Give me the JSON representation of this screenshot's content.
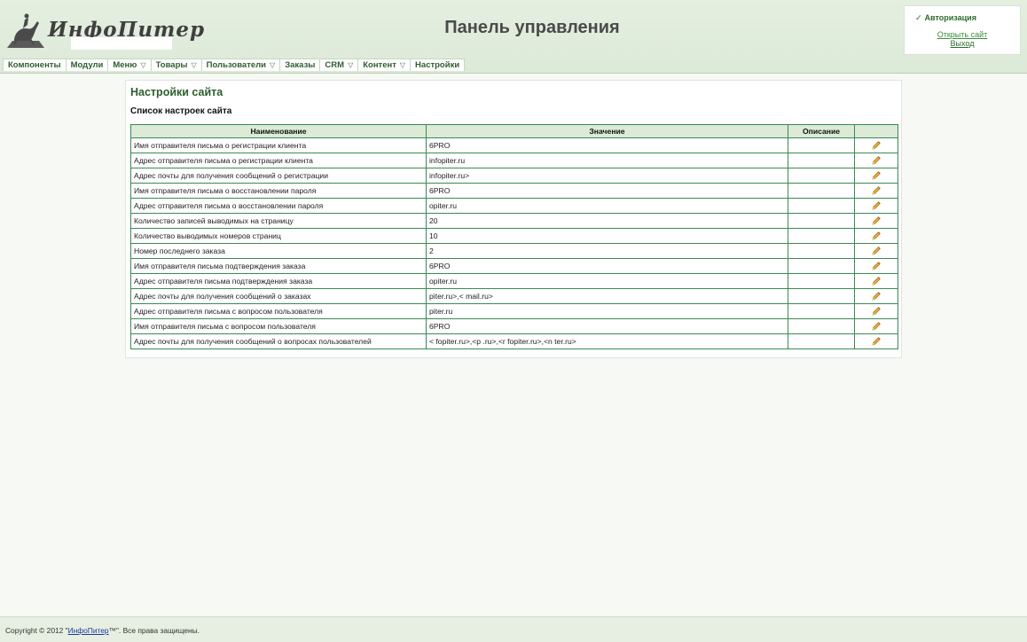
{
  "header": {
    "logo_text": "ИнфоПитер",
    "title": "Панель управления"
  },
  "auth": {
    "title": "Авторизация",
    "open_site": "Открыть сайт",
    "logout": "Выход"
  },
  "nav": [
    {
      "label": "Компоненты",
      "dropdown": false
    },
    {
      "label": "Модули",
      "dropdown": false
    },
    {
      "label": "Меню",
      "dropdown": true
    },
    {
      "label": "Товары",
      "dropdown": true
    },
    {
      "label": "Пользователи",
      "dropdown": true
    },
    {
      "label": "Заказы",
      "dropdown": false
    },
    {
      "label": "CRM",
      "dropdown": true
    },
    {
      "label": "Контент",
      "dropdown": true
    },
    {
      "label": "Настройки",
      "dropdown": false
    }
  ],
  "content": {
    "title": "Настройки сайта",
    "subtitle": "Список настроек сайта",
    "columns": [
      "Наименование",
      "Значение",
      "Описание",
      ""
    ],
    "rows": [
      {
        "name": "Имя отправителя письма о регистрации клиента",
        "value": "6PRO",
        "description": ""
      },
      {
        "name": "Адрес отправителя письма о регистрации клиента",
        "value": "              infopiter.ru",
        "description": ""
      },
      {
        "name": "Адрес почты для получения сообщений о регистрации",
        "value": "               infopiter.ru>",
        "description": ""
      },
      {
        "name": "Имя отправителя письма о восстановлении пароля",
        "value": "6PRO",
        "description": ""
      },
      {
        "name": "Адрес отправителя письма о восстановлении пароля",
        "value": "                  opiter.ru",
        "description": ""
      },
      {
        "name": "Количество записей выводимых на страницу",
        "value": "20",
        "description": ""
      },
      {
        "name": "Количество выводимых номеров страниц",
        "value": "10",
        "description": ""
      },
      {
        "name": "Номер последнего заказа",
        "value": "2",
        "description": ""
      },
      {
        "name": "Имя отправителя письма подтверждения заказа",
        "value": "6PRO",
        "description": ""
      },
      {
        "name": "Адрес отправителя письма подтверждения заказа",
        "value": "                  opiter.ru",
        "description": ""
      },
      {
        "name": "Адрес почты для получения сообщений о заказах",
        "value": "               piter.ru>,<              mail.ru>",
        "description": ""
      },
      {
        "name": "Адрес отправителя письма с вопросом пользователя",
        "value": "                  piter.ru",
        "description": ""
      },
      {
        "name": "Имя отправителя письма с вопросом пользователя",
        "value": "6PRO",
        "description": ""
      },
      {
        "name": "Адрес почты для получения сообщений о вопросах пользователей",
        "value": "<             fopiter.ru>,<p             .ru>,<r            fopiter.ru>,<n             ter.ru>",
        "description": ""
      }
    ]
  },
  "footer": {
    "prefix": "Copyright © 2012 \"",
    "link": "ИнфоПитер",
    "suffix": "™\". Все права защищены."
  },
  "colors": {
    "accent_green": "#2b5e2b",
    "table_border": "#3a8a55",
    "header_bg": "#e4efe0",
    "pencil": "#e0a020"
  },
  "icons": {
    "logo": "horseman-monument-icon",
    "auth": "check-icon",
    "nav_dropdown": "triangle-down-icon",
    "row_action": "pencil-icon"
  }
}
